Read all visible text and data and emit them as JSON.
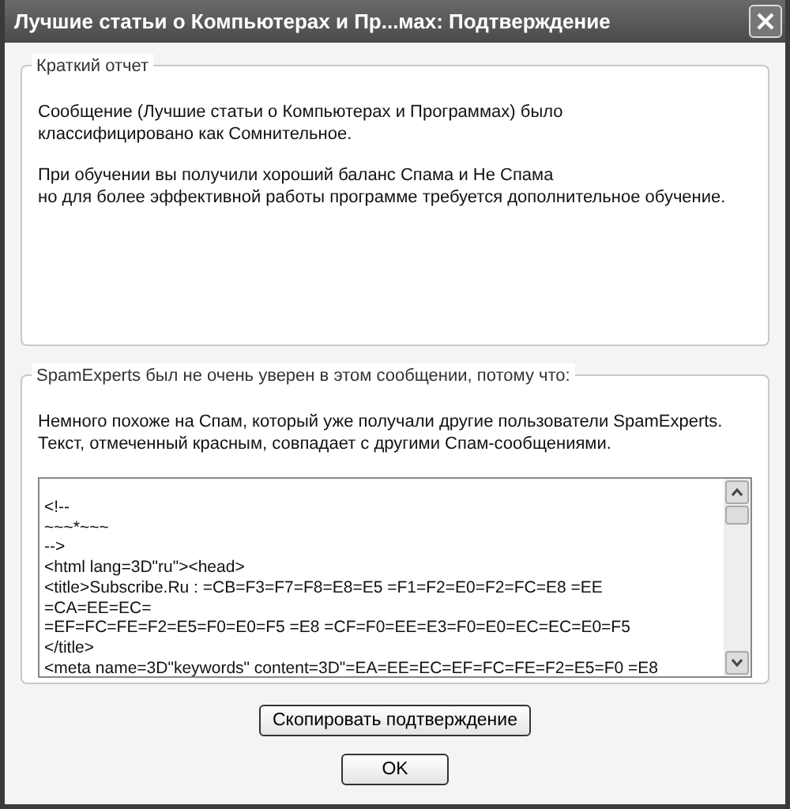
{
  "window": {
    "title": "Лучшие статьи о Компьютерах и Пр...мах: Подтверждение"
  },
  "summary": {
    "legend": "Краткий отчет",
    "paragraphs": [
      [
        "Сообщение (Лучшие статьи о Компьютерах и Программах) было",
        "классифицировано как Сомнительное."
      ],
      [
        "При обучении вы получили хороший баланс Спама и Не Спама",
        "но для более эффективной работы программе требуется дополнительное обучение."
      ]
    ]
  },
  "reason": {
    "legend": "SpamExperts был не очень уверен в этом сообщении, потому что:",
    "explanation": [
      "Немного похоже на Спам, который уже получали другие пользователи SpamExperts.",
      "Текст, отмеченный красным, совпадает с другими Спам-сообщениями."
    ],
    "source_lines": [
      "<!--",
      "~~~*~~~",
      "-->",
      "<html lang=3D\"ru\"><head>",
      "<title>Subscribe.Ru : =CB=F3=F7=F8=E8=E5 =F1=F2=E0=F2=FC=E8 =EE",
      "=CA=EE=EC=",
      "=EF=FC=FE=F2=E5=F0=E0=F5 =E8 =CF=F0=EE=E3=F0=E0=EC=EC=E0=F5",
      "</title>",
      "<meta name=3D\"keywords\" content=3D\"=EA=EE=EC=EF=FC=FE=F2=E5=F0 =E8"
    ]
  },
  "buttons": [
    "Скопировать подтверждение",
    "OK"
  ]
}
